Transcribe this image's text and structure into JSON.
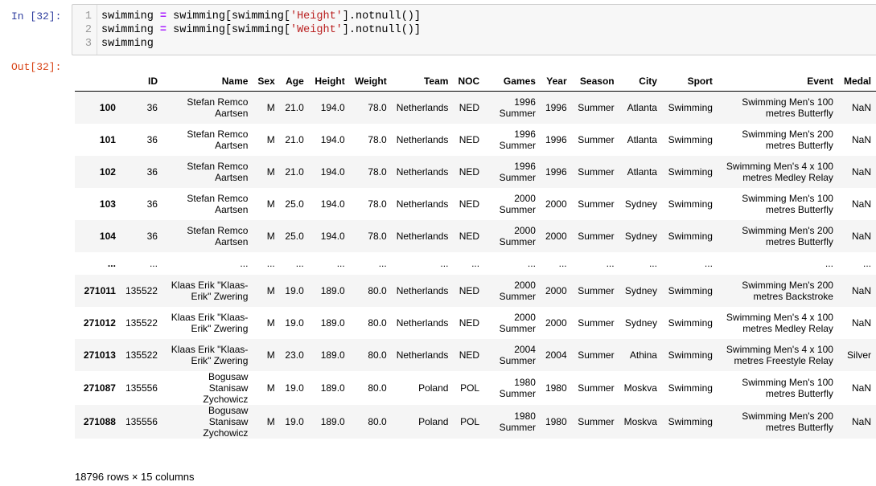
{
  "input_prompt": "In [32]:",
  "output_prompt": "Out[32]:",
  "code": {
    "line_numbers": [
      "1",
      "2",
      "3"
    ],
    "lines": [
      [
        {
          "t": "swimming "
        },
        {
          "t": "=",
          "c": "op"
        },
        {
          "t": " swimming[swimming["
        },
        {
          "t": "'Height'",
          "c": "str"
        },
        {
          "t": "].notnull()]"
        }
      ],
      [
        {
          "t": "swimming "
        },
        {
          "t": "=",
          "c": "op"
        },
        {
          "t": " swimming[swimming["
        },
        {
          "t": "'Weight'",
          "c": "str"
        },
        {
          "t": "].notnull()]"
        }
      ],
      [
        {
          "t": "swimming"
        }
      ]
    ]
  },
  "table": {
    "columns": [
      "",
      "ID",
      "Name",
      "Sex",
      "Age",
      "Height",
      "Weight",
      "Team",
      "NOC",
      "Games",
      "Year",
      "Season",
      "City",
      "Sport",
      "Event",
      "Medal"
    ],
    "rows": [
      [
        "100",
        "36",
        "Stefan Remco Aartsen",
        "M",
        "21.0",
        "194.0",
        "78.0",
        "Netherlands",
        "NED",
        "1996 Summer",
        "1996",
        "Summer",
        "Atlanta",
        "Swimming",
        "Swimming Men's 100 metres Butterfly",
        "NaN"
      ],
      [
        "101",
        "36",
        "Stefan Remco Aartsen",
        "M",
        "21.0",
        "194.0",
        "78.0",
        "Netherlands",
        "NED",
        "1996 Summer",
        "1996",
        "Summer",
        "Atlanta",
        "Swimming",
        "Swimming Men's 200 metres Butterfly",
        "NaN"
      ],
      [
        "102",
        "36",
        "Stefan Remco Aartsen",
        "M",
        "21.0",
        "194.0",
        "78.0",
        "Netherlands",
        "NED",
        "1996 Summer",
        "1996",
        "Summer",
        "Atlanta",
        "Swimming",
        "Swimming Men's 4 x 100 metres Medley Relay",
        "NaN"
      ],
      [
        "103",
        "36",
        "Stefan Remco Aartsen",
        "M",
        "25.0",
        "194.0",
        "78.0",
        "Netherlands",
        "NED",
        "2000 Summer",
        "2000",
        "Summer",
        "Sydney",
        "Swimming",
        "Swimming Men's 100 metres Butterfly",
        "NaN"
      ],
      [
        "104",
        "36",
        "Stefan Remco Aartsen",
        "M",
        "25.0",
        "194.0",
        "78.0",
        "Netherlands",
        "NED",
        "2000 Summer",
        "2000",
        "Summer",
        "Sydney",
        "Swimming",
        "Swimming Men's 200 metres Butterfly",
        "NaN"
      ],
      [
        "...",
        "...",
        "...",
        "...",
        "...",
        "...",
        "...",
        "...",
        "...",
        "...",
        "...",
        "...",
        "...",
        "...",
        "...",
        "..."
      ],
      [
        "271011",
        "135522",
        "Klaas Erik \"Klaas-Erik\" Zwering",
        "M",
        "19.0",
        "189.0",
        "80.0",
        "Netherlands",
        "NED",
        "2000 Summer",
        "2000",
        "Summer",
        "Sydney",
        "Swimming",
        "Swimming Men's 200 metres Backstroke",
        "NaN"
      ],
      [
        "271012",
        "135522",
        "Klaas Erik \"Klaas-Erik\" Zwering",
        "M",
        "19.0",
        "189.0",
        "80.0",
        "Netherlands",
        "NED",
        "2000 Summer",
        "2000",
        "Summer",
        "Sydney",
        "Swimming",
        "Swimming Men's 4 x 100 metres Medley Relay",
        "NaN"
      ],
      [
        "271013",
        "135522",
        "Klaas Erik \"Klaas-Erik\" Zwering",
        "M",
        "23.0",
        "189.0",
        "80.0",
        "Netherlands",
        "NED",
        "2004 Summer",
        "2004",
        "Summer",
        "Athina",
        "Swimming",
        "Swimming Men's 4 x 100 metres Freestyle Relay",
        "Silver"
      ],
      [
        "271087",
        "135556",
        "Bogusaw Stanisaw Zychowicz",
        "M",
        "19.0",
        "189.0",
        "80.0",
        "Poland",
        "POL",
        "1980 Summer",
        "1980",
        "Summer",
        "Moskva",
        "Swimming",
        "Swimming Men's 100 metres Butterfly",
        "NaN"
      ],
      [
        "271088",
        "135556",
        "Bogusaw Stanisaw Zychowicz",
        "M",
        "19.0",
        "189.0",
        "80.0",
        "Poland",
        "POL",
        "1980 Summer",
        "1980",
        "Summer",
        "Moskva",
        "Swimming",
        "Swimming Men's 200 metres Butterfly",
        "NaN"
      ]
    ]
  },
  "footer": "18796 rows × 15 columns"
}
